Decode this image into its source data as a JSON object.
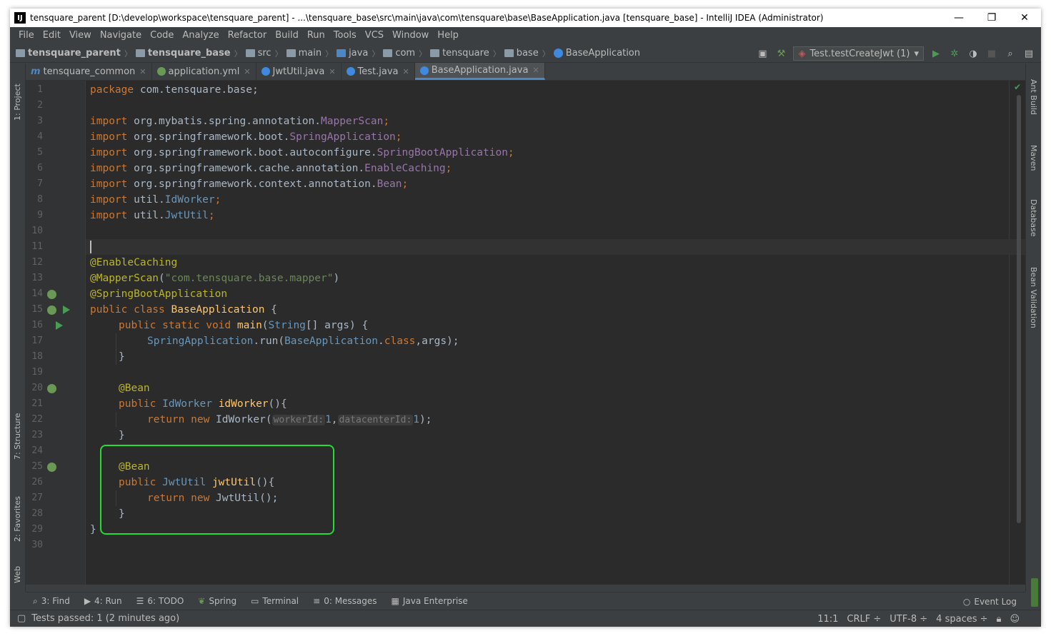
{
  "window": {
    "title": "tensquare_parent [D:\\develop\\workspace\\tensquare_parent] - ...\\tensquare_base\\src\\main\\java\\com\\tensquare\\base\\BaseApplication.java [tensquare_base] - IntelliJ IDEA (Administrator)",
    "app_icon": "IJ",
    "minimize": "—",
    "maximize": "❐",
    "close": "✕"
  },
  "menu": [
    "File",
    "Edit",
    "View",
    "Navigate",
    "Code",
    "Analyze",
    "Refactor",
    "Build",
    "Run",
    "Tools",
    "VCS",
    "Window",
    "Help"
  ],
  "breadcrumb": [
    "tensquare_parent",
    "tensquare_base",
    "src",
    "main",
    "java",
    "com",
    "tensquare",
    "base",
    "BaseApplication"
  ],
  "run_config": "Test.testCreateJwt (1)",
  "tabs": [
    {
      "label": "tensquare_common",
      "icon_color": "#4a88c7"
    },
    {
      "label": "application.yml",
      "icon_color": "#6a9955"
    },
    {
      "label": "JwtUtil.java",
      "icon_color": "#3d8ae0"
    },
    {
      "label": "Test.java",
      "icon_color": "#3d8ae0"
    },
    {
      "label": "BaseApplication.java",
      "icon_color": "#3d8ae0"
    }
  ],
  "left_tools": [
    "1: Project",
    "7: Structure",
    "2: Favorites",
    "Web"
  ],
  "right_tools": [
    "Ant Build",
    "Maven",
    "Database",
    "Bean Validation"
  ],
  "code": {
    "l1": {
      "a": "package",
      "b": " com.tensquare.base;"
    },
    "l3": {
      "a": "import",
      "b": " org.mybatis.spring.annotation.",
      "c": "MapperScan",
      "d": ";"
    },
    "l4": {
      "a": "import",
      "b": " org.springframework.boot.",
      "c": "SpringApplication",
      "d": ";"
    },
    "l5": {
      "a": "import",
      "b": " org.springframework.boot.autoconfigure.",
      "c": "SpringBootApplication",
      "d": ";"
    },
    "l6": {
      "a": "import",
      "b": " org.springframework.cache.annotation.",
      "c": "EnableCaching",
      "d": ";"
    },
    "l7": {
      "a": "import",
      "b": " org.springframework.context.annotation.",
      "c": "Bean",
      "d": ";"
    },
    "l8": {
      "a": "import",
      "b": " util.",
      "c": "IdWorker",
      "d": ";"
    },
    "l9": {
      "a": "import",
      "b": " util.",
      "c": "JwtUtil",
      "d": ";"
    },
    "l12": {
      "a": "@EnableCaching"
    },
    "l13": {
      "a": "@MapperScan",
      "b": "(",
      "c": "\"com.tensquare.base.mapper\"",
      "d": ")"
    },
    "l14": {
      "a": "@SpringBootApplication"
    },
    "l15": {
      "a": "public class ",
      "b": "BaseApplication",
      "c": " {"
    },
    "l16": {
      "a": "public static void ",
      "b": "main",
      "c": "(",
      "d": "String",
      "e": "[] args) {"
    },
    "l17": {
      "a": "SpringApplication",
      "b": ".run(",
      "c": "BaseApplication",
      "d": ".",
      "e": "class",
      "f": ",args);"
    },
    "l18": {
      "a": "}"
    },
    "l20": {
      "a": "@Bean"
    },
    "l21": {
      "a": "public ",
      "b": "IdWorker",
      "c": " ",
      "d": "idWorker",
      "e": "(){"
    },
    "l22": {
      "a": "return new ",
      "b": "IdWorker(",
      "h1": "workerId:",
      "v1": "1",
      "sep": ",",
      "h2": "datacenterId:",
      "v2": "1",
      "end": ");"
    },
    "l23": {
      "a": "}"
    },
    "l25": {
      "a": "@Bean"
    },
    "l26": {
      "a": "public ",
      "b": "JwtUtil",
      "c": " ",
      "d": "jwtUtil",
      "e": "(){"
    },
    "l27": {
      "a": "return new ",
      "b": "JwtUtil();"
    },
    "l28": {
      "a": "}"
    },
    "l29": {
      "a": "}"
    }
  },
  "line_numbers": [
    "1",
    "2",
    "3",
    "4",
    "5",
    "6",
    "7",
    "8",
    "9",
    "10",
    "11",
    "12",
    "13",
    "14",
    "15",
    "16",
    "17",
    "18",
    "19",
    "20",
    "21",
    "22",
    "23",
    "24",
    "25",
    "26",
    "27",
    "28",
    "29",
    "30"
  ],
  "bottom_tools": [
    "3: Find",
    "4: Run",
    "6: TODO",
    "Spring",
    "Terminal",
    "0: Messages",
    "Java Enterprise"
  ],
  "event_log": "Event Log",
  "status": {
    "message": "Tests passed: 1 (2 minutes ago)",
    "position": "11:1",
    "line_sep": "CRLF ÷",
    "encoding": "UTF-8 ÷",
    "indent": "4 spaces ÷"
  },
  "colors": {
    "accent": "#4a88c7",
    "highlight_box": "#22dd33",
    "editor_bg": "#2b2b2b",
    "keyword": "#cc7832"
  }
}
